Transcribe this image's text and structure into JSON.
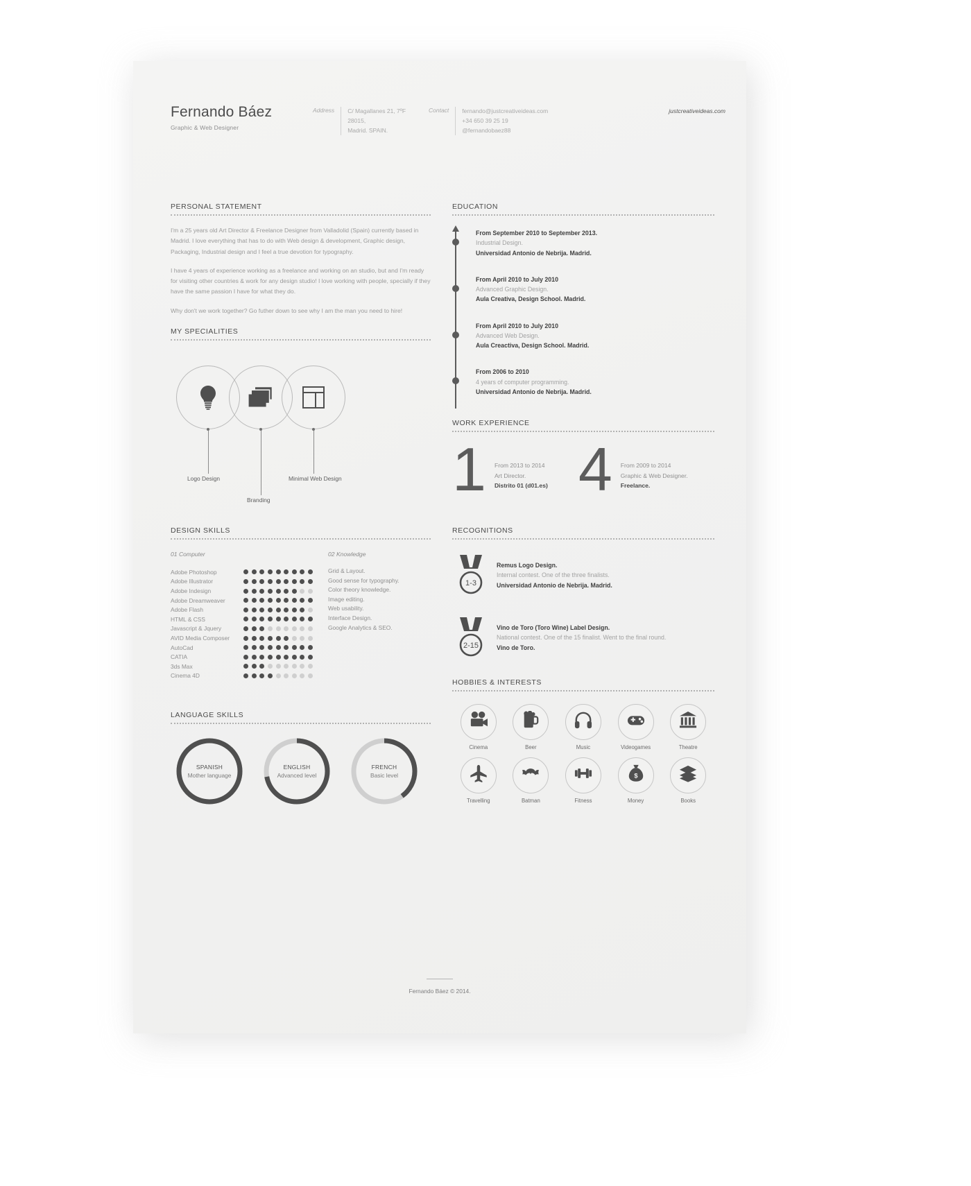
{
  "header": {
    "name": "Fernando Báez",
    "role": "Graphic & Web Designer",
    "address_label": "Address",
    "address_lines": [
      "C/ Magallanes 21, 7ºF",
      "28015,",
      "Madrid. SPAIN."
    ],
    "contact_label": "Contact",
    "contact_lines": [
      "fernando@justcreativeideas.com",
      "+34 650 39 25 19",
      "@fernandobaez88"
    ],
    "website": "justcreativeideas.com"
  },
  "personal_statement": {
    "title": "PERSONAL STATEMENT",
    "paragraphs": [
      "I'm a 25 years old Art Director & Freelance Designer from Valladolid (Spain) currently based in Madrid. I love everything that has to do with Web design & development, Graphic design, Packaging, Industrial design and I feel a true devotion for typography.",
      "I have 4 years of experience working as a freelance and working on an studio, but and I'm ready for visiting other countries & work for any design studio! I love working with people, specially if they have the same passion I have for what they do.",
      "Why don't we work together? Go futher down to see why I am the man you need to hire!"
    ]
  },
  "specialities": {
    "title": "MY SPECIALITIES",
    "items": [
      {
        "label": "Logo Design",
        "icon": "lightbulb-icon"
      },
      {
        "label": "Branding",
        "icon": "layers-icon"
      },
      {
        "label": "Minimal Web Design",
        "icon": "layout-icon"
      }
    ]
  },
  "design_skills": {
    "title": "DESIGN SKILLS",
    "computer_header": "01 Computer",
    "knowledge_header": "02 Knowledge",
    "max_dots": 9,
    "computer": [
      {
        "name": "Adobe Photoshop",
        "level": 9
      },
      {
        "name": "Adobe Illustrator",
        "level": 9
      },
      {
        "name": "Adobe Indesign",
        "level": 7
      },
      {
        "name": "Adobe Dreamweaver",
        "level": 9
      },
      {
        "name": "Adobe Flash",
        "level": 8
      },
      {
        "name": "HTML & CSS",
        "level": 9
      },
      {
        "name": "Javascript & Jquery",
        "level": 3
      },
      {
        "name": "AVID Media Composer",
        "level": 6
      },
      {
        "name": "AutoCad",
        "level": 9
      },
      {
        "name": "CATIA",
        "level": 9
      },
      {
        "name": "3ds Max",
        "level": 3
      },
      {
        "name": "Cinema 4D",
        "level": 4
      }
    ],
    "knowledge": [
      "Grid & Layout.",
      "Good sense for typography.",
      "Color theory knowledge.",
      "Image editing.",
      "Web usability.",
      "Interface Design.",
      "Google Analytics & SEO."
    ]
  },
  "language_skills": {
    "title": "LANGUAGE SKILLS",
    "items": [
      {
        "name": "SPANISH",
        "level_label": "Mother language",
        "percent": 100
      },
      {
        "name": "ENGLISH",
        "level_label": "Advanced level",
        "percent": 72
      },
      {
        "name": "FRENCH",
        "level_label": "Basic level",
        "percent": 40
      }
    ]
  },
  "education": {
    "title": "EDUCATION",
    "items": [
      {
        "period": "From September 2010 to September 2013.",
        "subject": "Industrial Design.",
        "school": "Universidad Antonio de Nebrija. Madrid."
      },
      {
        "period": "From April 2010 to July 2010",
        "subject": "Advanced Graphic Design.",
        "school": "Aula Creativa, Design School. Madrid."
      },
      {
        "period": "From April 2010 to July 2010",
        "subject": "Advanced Web Design.",
        "school": "Aula Creactiva, Design School. Madrid."
      },
      {
        "period": "From 2006 to 2010",
        "subject": "4 years of computer programming.",
        "school": "Universidad Antonio de Nebrija. Madrid."
      }
    ]
  },
  "work_experience": {
    "title": "WORK EXPERIENCE",
    "items": [
      {
        "number": "1",
        "period": "From 2013 to 2014",
        "role": "Art Director.",
        "company": "Distrito 01 (d01.es)"
      },
      {
        "number": "4",
        "period": "From 2009 to 2014",
        "role": "Graphic & Web Designer.",
        "company": "Freelance."
      }
    ]
  },
  "recognitions": {
    "title": "RECOGNITIONS",
    "items": [
      {
        "badge": "1-3",
        "title": "Remus Logo Design.",
        "detail": "Internal contest. One of the three finalists.",
        "org": "Universidad Antonio de Nebrija. Madrid."
      },
      {
        "badge": "2-15",
        "title": "Vino de Toro (Toro Wine) Label Design.",
        "detail": "National contest. One of the 15 finalist. Went to the final round.",
        "org": "Vino de Toro."
      }
    ]
  },
  "hobbies": {
    "title": "HOBBIES & INTERESTS",
    "items": [
      {
        "label": "Cinema",
        "icon": "film-camera-icon"
      },
      {
        "label": "Beer",
        "icon": "beer-mug-icon"
      },
      {
        "label": "Music",
        "icon": "headphones-icon"
      },
      {
        "label": "Videogames",
        "icon": "gamepad-icon"
      },
      {
        "label": "Theatre",
        "icon": "theatre-building-icon"
      },
      {
        "label": "Travelling",
        "icon": "airplane-icon"
      },
      {
        "label": "Batman",
        "icon": "batman-icon"
      },
      {
        "label": "Fitness",
        "icon": "dumbbell-icon"
      },
      {
        "label": "Money",
        "icon": "money-bag-icon"
      },
      {
        "label": "Books",
        "icon": "books-icon"
      }
    ]
  },
  "footer": {
    "text": "Fernando Báez © 2014."
  },
  "colors": {
    "ink": "#4a4a4a",
    "muted": "#9a9a9a",
    "paper": "#f2f2f1",
    "dot_on": "#4f4f4f",
    "dot_off": "#cfcfcf"
  }
}
